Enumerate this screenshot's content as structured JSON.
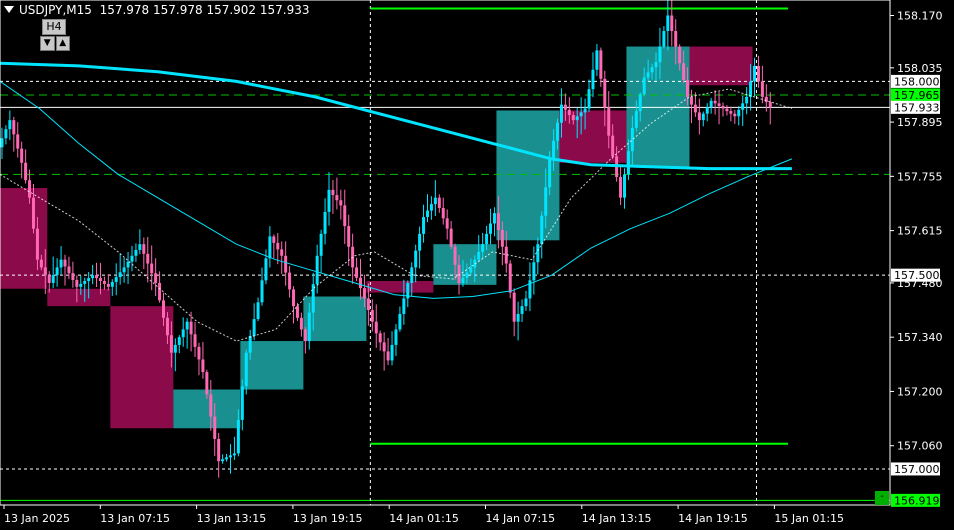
{
  "header": {
    "symbol": "USDJPY,M15",
    "ohlc": "157.978 157.978 157.902 157.933"
  },
  "timeframe_control": {
    "label": "H4",
    "down_icon": "triangle-down-icon",
    "up_icon": "triangle-up-icon"
  },
  "corner_button_label": "-",
  "colors": {
    "background": "#000000",
    "bull_candle": "#00e5ff",
    "bear_candle": "#ff69b4",
    "bull_box": "#1a8f8f",
    "bear_box": "#8b0a4a",
    "green_level": "#00ff00",
    "ma_line": "#00e5ff",
    "grid_line": "#ffffff",
    "price_tag_current": "#00ff00",
    "price_tag_round": "#ffffff"
  },
  "chart_data": {
    "type": "candlestick",
    "x_tick_labels": [
      "13 Jan 2025",
      "13 Jan 07:15",
      "13 Jan 13:15",
      "13 Jan 19:15",
      "14 Jan 01:15",
      "14 Jan 07:15",
      "14 Jan 13:15",
      "14 Jan 19:15",
      "15 Jan 01:15"
    ],
    "y_tick_labels": [
      "158.170",
      "158.035",
      "157.895",
      "157.755",
      "157.615",
      "157.480",
      "157.340",
      "157.200",
      "157.060"
    ],
    "y_ticks": [
      158.17,
      158.035,
      157.895,
      157.755,
      157.615,
      157.48,
      157.34,
      157.2,
      157.06
    ],
    "ylim": [
      156.907,
      158.21
    ],
    "xlim_bars": [
      0,
      200
    ],
    "price_tags": [
      {
        "label": "158.000",
        "value": 158.0,
        "kind": "round"
      },
      {
        "label": "157.965",
        "value": 157.965,
        "kind": "level"
      },
      {
        "label": "157.933",
        "value": 157.933,
        "kind": "current"
      },
      {
        "label": "157.500",
        "value": 157.5,
        "kind": "round"
      },
      {
        "label": "157.000",
        "value": 157.0,
        "kind": "round"
      },
      {
        "label": "156.919",
        "value": 156.919,
        "kind": "level"
      }
    ],
    "horizontal_lines": [
      {
        "value": 158.0,
        "style": "dotted",
        "color": "#ffffff"
      },
      {
        "value": 157.933,
        "style": "solid",
        "color": "#ffffff"
      },
      {
        "value": 157.5,
        "style": "dotted",
        "color": "#ffffff"
      },
      {
        "value": 157.0,
        "style": "dotted",
        "color": "#ffffff"
      },
      {
        "value": 157.965,
        "style": "dashed",
        "color": "#00c000"
      },
      {
        "value": 157.76,
        "style": "dashed",
        "color": "#00c000"
      },
      {
        "value": 156.919,
        "style": "solid",
        "color": "#00ff00"
      }
    ],
    "range_lines": [
      {
        "value": 158.188,
        "from_bar": 94,
        "to_bar": 200,
        "color": "#00ff00"
      },
      {
        "value": 157.065,
        "from_bar": 94,
        "to_bar": 200,
        "color": "#00ff00"
      }
    ],
    "session_separators_bar": [
      94,
      192
    ],
    "h4_boxes": [
      {
        "from_bar": 0,
        "to_bar": 12,
        "open": 157.725,
        "close": 157.465,
        "dir": "bear"
      },
      {
        "from_bar": 12,
        "to_bar": 28,
        "open": 157.465,
        "close": 157.42,
        "dir": "bear"
      },
      {
        "from_bar": 28,
        "to_bar": 44,
        "open": 157.42,
        "close": 157.105,
        "dir": "bear"
      },
      {
        "from_bar": 44,
        "to_bar": 61,
        "open": 157.105,
        "close": 157.205,
        "dir": "bull"
      },
      {
        "from_bar": 61,
        "to_bar": 77,
        "open": 157.205,
        "close": 157.33,
        "dir": "bull"
      },
      {
        "from_bar": 77,
        "to_bar": 93,
        "open": 157.33,
        "close": 157.445,
        "dir": "bull"
      },
      {
        "from_bar": 93,
        "to_bar": 110,
        "open": 157.485,
        "close": 157.455,
        "dir": "bear"
      },
      {
        "from_bar": 110,
        "to_bar": 126,
        "open": 157.475,
        "close": 157.58,
        "dir": "bull"
      },
      {
        "from_bar": 126,
        "to_bar": 142,
        "open": 157.59,
        "close": 157.925,
        "dir": "bull"
      },
      {
        "from_bar": 142,
        "to_bar": 159,
        "open": 157.925,
        "close": 157.79,
        "dir": "bear"
      },
      {
        "from_bar": 159,
        "to_bar": 175,
        "open": 157.78,
        "close": 158.09,
        "dir": "bull"
      },
      {
        "from_bar": 175,
        "to_bar": 191,
        "open": 158.09,
        "close": 157.99,
        "dir": "bear"
      }
    ],
    "thick_ma": [
      [
        0,
        158.047
      ],
      [
        20,
        158.04
      ],
      [
        40,
        158.025
      ],
      [
        60,
        158.0
      ],
      [
        80,
        157.96
      ],
      [
        95,
        157.92
      ],
      [
        110,
        157.88
      ],
      [
        125,
        157.84
      ],
      [
        140,
        157.8
      ],
      [
        150,
        157.785
      ],
      [
        165,
        157.78
      ],
      [
        180,
        157.775
      ],
      [
        201,
        157.775
      ]
    ],
    "thin_ma": [
      [
        0,
        158.0
      ],
      [
        10,
        157.93
      ],
      [
        20,
        157.84
      ],
      [
        30,
        157.76
      ],
      [
        40,
        157.7
      ],
      [
        50,
        157.64
      ],
      [
        60,
        157.58
      ],
      [
        70,
        157.54
      ],
      [
        80,
        157.51
      ],
      [
        90,
        157.48
      ],
      [
        100,
        157.45
      ],
      [
        110,
        157.44
      ],
      [
        120,
        157.445
      ],
      [
        130,
        157.46
      ],
      [
        140,
        157.5
      ],
      [
        150,
        157.57
      ],
      [
        160,
        157.62
      ],
      [
        170,
        157.66
      ],
      [
        180,
        157.71
      ],
      [
        190,
        157.755
      ],
      [
        201,
        157.8
      ]
    ],
    "dashed_ma": [
      [
        0,
        157.76
      ],
      [
        10,
        157.7
      ],
      [
        20,
        157.64
      ],
      [
        30,
        157.56
      ],
      [
        40,
        157.47
      ],
      [
        50,
        157.38
      ],
      [
        60,
        157.33
      ],
      [
        70,
        157.36
      ],
      [
        80,
        157.47
      ],
      [
        90,
        157.55
      ],
      [
        95,
        157.56
      ],
      [
        105,
        157.5
      ],
      [
        115,
        157.49
      ],
      [
        125,
        157.56
      ],
      [
        135,
        157.54
      ],
      [
        145,
        157.7
      ],
      [
        155,
        157.8
      ],
      [
        165,
        157.89
      ],
      [
        175,
        157.96
      ],
      [
        185,
        157.98
      ],
      [
        201,
        157.93
      ]
    ],
    "candle_anchors": [
      [
        0,
        157.83
      ],
      [
        3,
        157.9
      ],
      [
        6,
        157.79
      ],
      [
        8,
        157.7
      ],
      [
        10,
        157.54
      ],
      [
        13,
        157.48
      ],
      [
        16,
        157.54
      ],
      [
        20,
        157.47
      ],
      [
        24,
        157.5
      ],
      [
        28,
        157.47
      ],
      [
        32,
        157.52
      ],
      [
        36,
        157.58
      ],
      [
        40,
        157.48
      ],
      [
        44,
        157.3
      ],
      [
        48,
        157.38
      ],
      [
        52,
        157.25
      ],
      [
        56,
        157.02
      ],
      [
        60,
        157.04
      ],
      [
        63,
        157.3
      ],
      [
        66,
        157.43
      ],
      [
        69,
        157.6
      ],
      [
        72,
        157.55
      ],
      [
        75,
        157.42
      ],
      [
        78,
        157.33
      ],
      [
        81,
        157.55
      ],
      [
        84,
        157.72
      ],
      [
        87,
        157.68
      ],
      [
        90,
        157.52
      ],
      [
        93,
        157.44
      ],
      [
        96,
        157.35
      ],
      [
        99,
        157.28
      ],
      [
        102,
        157.4
      ],
      [
        105,
        157.52
      ],
      [
        108,
        157.65
      ],
      [
        111,
        157.7
      ],
      [
        114,
        157.62
      ],
      [
        117,
        157.48
      ],
      [
        120,
        157.52
      ],
      [
        123,
        157.58
      ],
      [
        126,
        157.66
      ],
      [
        129,
        157.53
      ],
      [
        131,
        157.38
      ],
      [
        134,
        157.44
      ],
      [
        137,
        157.58
      ],
      [
        140,
        157.8
      ],
      [
        143,
        157.94
      ],
      [
        146,
        157.9
      ],
      [
        149,
        157.93
      ],
      [
        152,
        158.08
      ],
      [
        155,
        157.86
      ],
      [
        158,
        157.7
      ],
      [
        161,
        157.88
      ],
      [
        164,
        158.01
      ],
      [
        167,
        158.05
      ],
      [
        170,
        158.17
      ],
      [
        172,
        158.09
      ],
      [
        175,
        157.96
      ],
      [
        178,
        157.9
      ],
      [
        181,
        157.95
      ],
      [
        184,
        157.93
      ],
      [
        187,
        157.91
      ],
      [
        190,
        157.96
      ],
      [
        192,
        158.04
      ],
      [
        194,
        157.96
      ],
      [
        196,
        157.933
      ]
    ]
  }
}
